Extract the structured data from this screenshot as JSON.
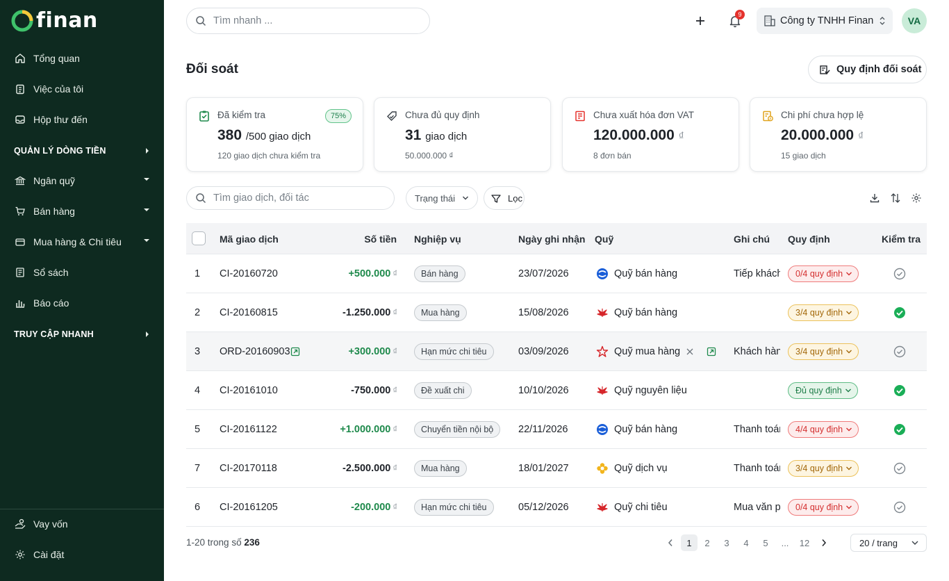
{
  "brand": {
    "name": "finan",
    "accent": "#1f8a4c",
    "sidebar_bg": "#0e2a20"
  },
  "sidebar": {
    "items": [
      {
        "label": "Tổng quan",
        "icon": "home-icon"
      },
      {
        "label": "Việc của tôi",
        "icon": "clipboard-icon"
      },
      {
        "label": "Hộp thư đến",
        "icon": "inbox-icon"
      }
    ],
    "section_cashflow": "QUẢN LÝ DÒNG TIỀN",
    "cashflow_items": [
      {
        "label": "Ngân quỹ",
        "icon": "bank-icon"
      },
      {
        "label": "Bán hàng",
        "icon": "cart-icon"
      },
      {
        "label": "Mua hàng & Chi tiêu",
        "icon": "wallet-icon"
      },
      {
        "label": "Sổ sách",
        "icon": "ledger-icon"
      },
      {
        "label": "Báo cáo",
        "icon": "chart-icon"
      }
    ],
    "section_quick": "TRUY CẬP NHANH",
    "bottom_items": [
      {
        "label": "Vay vốn",
        "icon": "loan-icon"
      },
      {
        "label": "Cài đặt",
        "icon": "gear-icon"
      }
    ]
  },
  "topbar": {
    "search_placeholder": "Tìm nhanh ...",
    "notification_count": "9",
    "company": "Công ty TNHH Finan",
    "avatar": "VA"
  },
  "page": {
    "title": "Đối soát",
    "rule_button": "Quy định đối soát"
  },
  "cards": [
    {
      "label": "Đã kiểm tra",
      "value": "380",
      "suffix": "/500 giao dịch",
      "sub": "120 giao dịch chưa kiểm tra",
      "badge": "75%"
    },
    {
      "label": "Chưa đủ quy định",
      "value": "31",
      "suffix": "giao dịch",
      "sub": "50.000.000 ₫"
    },
    {
      "label": "Chưa xuất hóa đơn VAT",
      "value": "120.000.000",
      "currency": "₫",
      "sub": "8 đơn bán"
    },
    {
      "label": "Chi phí chưa hợp lệ",
      "value": "20.000.000",
      "currency": "₫",
      "sub": "15 giao dịch"
    }
  ],
  "filters": {
    "search_placeholder": "Tìm giao dịch, đối tác",
    "status": "Trạng thái",
    "filter": "Lọc"
  },
  "table": {
    "headers": {
      "code": "Mã giao dịch",
      "amount": "Số tiền",
      "type": "Nghiệp vụ",
      "date": "Ngày ghi nhận",
      "fund": "Quỹ",
      "note": "Ghi chú",
      "rule": "Quy định",
      "check": "Kiểm tra"
    },
    "currency": "₫",
    "rows": [
      {
        "idx": "1",
        "code": "CI-20160720",
        "amount": "+500.000",
        "sign": "pos",
        "type": "Bán hàng",
        "date": "23/07/2026",
        "fund": "Quỹ bán hàng",
        "fund_icon": "globe-blue-icon",
        "note": "Tiếp khách",
        "rule": "0/4 quy định",
        "rule_status": "red",
        "checked": false
      },
      {
        "idx": "2",
        "code": "CI-20160815",
        "amount": "-1.250.000",
        "sign": "neg",
        "type": "Mua hàng",
        "date": "15/08/2026",
        "fund": "Quỹ bán hàng",
        "fund_icon": "leaf-red-icon",
        "note": "",
        "rule": "3/4 quy định",
        "rule_status": "yellow",
        "checked": true
      },
      {
        "idx": "3",
        "code": "ORD-20160903",
        "amount": "+300.000",
        "sign": "pos",
        "type": "Hạn mức chi tiêu",
        "date": "03/09/2026",
        "fund": "Quỹ mua hàng",
        "fund_icon": "star-red-icon",
        "note": "Khách hàng",
        "rule": "3/4 quy định",
        "rule_status": "yellow",
        "checked": false
      },
      {
        "idx": "4",
        "code": "CI-20161010",
        "amount": "-750.000",
        "sign": "neg",
        "type": "Đề xuất chi",
        "date": "10/10/2026",
        "fund": "Quỹ nguyên liệu",
        "fund_icon": "leaf-red-icon",
        "note": "",
        "rule": "Đủ quy định",
        "rule_status": "green",
        "checked": true
      },
      {
        "idx": "5",
        "code": "CI-20161122",
        "amount": "+1.000.000",
        "sign": "pos",
        "type": "Chuyển tiền nội bộ",
        "date": "22/11/2026",
        "fund": "Quỹ bán hàng",
        "fund_icon": "globe-blue-icon",
        "note": "Thanh toán",
        "rule": "4/4 quy định",
        "rule_status": "red",
        "checked": true
      },
      {
        "idx": "7",
        "code": "CI-20170118",
        "amount": "-2.500.000",
        "sign": "neg",
        "type": "Mua hàng",
        "date": "18/01/2027",
        "fund": "Quỹ dịch vụ",
        "fund_icon": "flower-yellow-icon",
        "note": "Thanh toán",
        "rule": "3/4 quy định",
        "rule_status": "yellow",
        "checked": false
      },
      {
        "idx": "6",
        "code": "CI-20161205",
        "amount": "-200.000",
        "sign": "pos",
        "type": "Hạn mức chi tiêu",
        "date": "05/12/2026",
        "fund": "Quỹ chi tiêu",
        "fund_icon": "leaf-red-icon",
        "note": "Mua văn phòng",
        "rule": "0/4 quy định",
        "rule_status": "red",
        "checked": false
      }
    ]
  },
  "pagination": {
    "range": "1-20",
    "of_text": "trong số",
    "total": "236",
    "pages": [
      "1",
      "2",
      "3",
      "4",
      "5",
      "...",
      "12"
    ],
    "per_page": "20 / trang"
  }
}
